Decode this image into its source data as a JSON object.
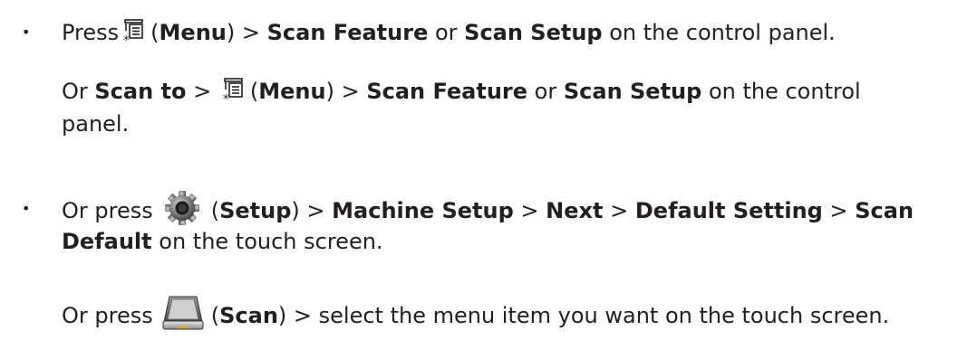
{
  "bullet_char": "•",
  "item1": {
    "line1": {
      "press": "Press",
      "open_paren": "(",
      "menu": "Menu",
      "after_menu": ") > ",
      "scan_feature": "Scan Feature",
      "or": " or ",
      "scan_setup": "Scan Setup",
      "tail": " on the control panel."
    },
    "line2": {
      "or": "Or ",
      "scan_to": "Scan to",
      "gt": " > ",
      "open_paren": "(",
      "menu": "Menu",
      "after_menu": ") > ",
      "scan_feature": "Scan Feature",
      "or2": " or ",
      "scan_setup": "Scan Setup",
      "tail": " on the control"
    },
    "line3": "panel."
  },
  "item2": {
    "line1": {
      "or_press": "Or press",
      "open_paren": "(",
      "setup": "Setup",
      "after_setup": ") > ",
      "machine_setup": "Machine Setup",
      "gt1": " > ",
      "next": "Next",
      "gt2": " > ",
      "default_setting": "Default Setting",
      "gt3": " > ",
      "scan": "Scan"
    },
    "line2": {
      "default": "Default",
      "tail": " on the touch screen."
    },
    "line3": {
      "or_press": "Or press",
      "open_paren": "(",
      "scan": "Scan",
      "tail": ") > select the menu item you want on the touch screen."
    }
  },
  "icons": {
    "menu": "menu-icon",
    "setup": "setup-gear-icon",
    "scan": "scanner-icon"
  }
}
